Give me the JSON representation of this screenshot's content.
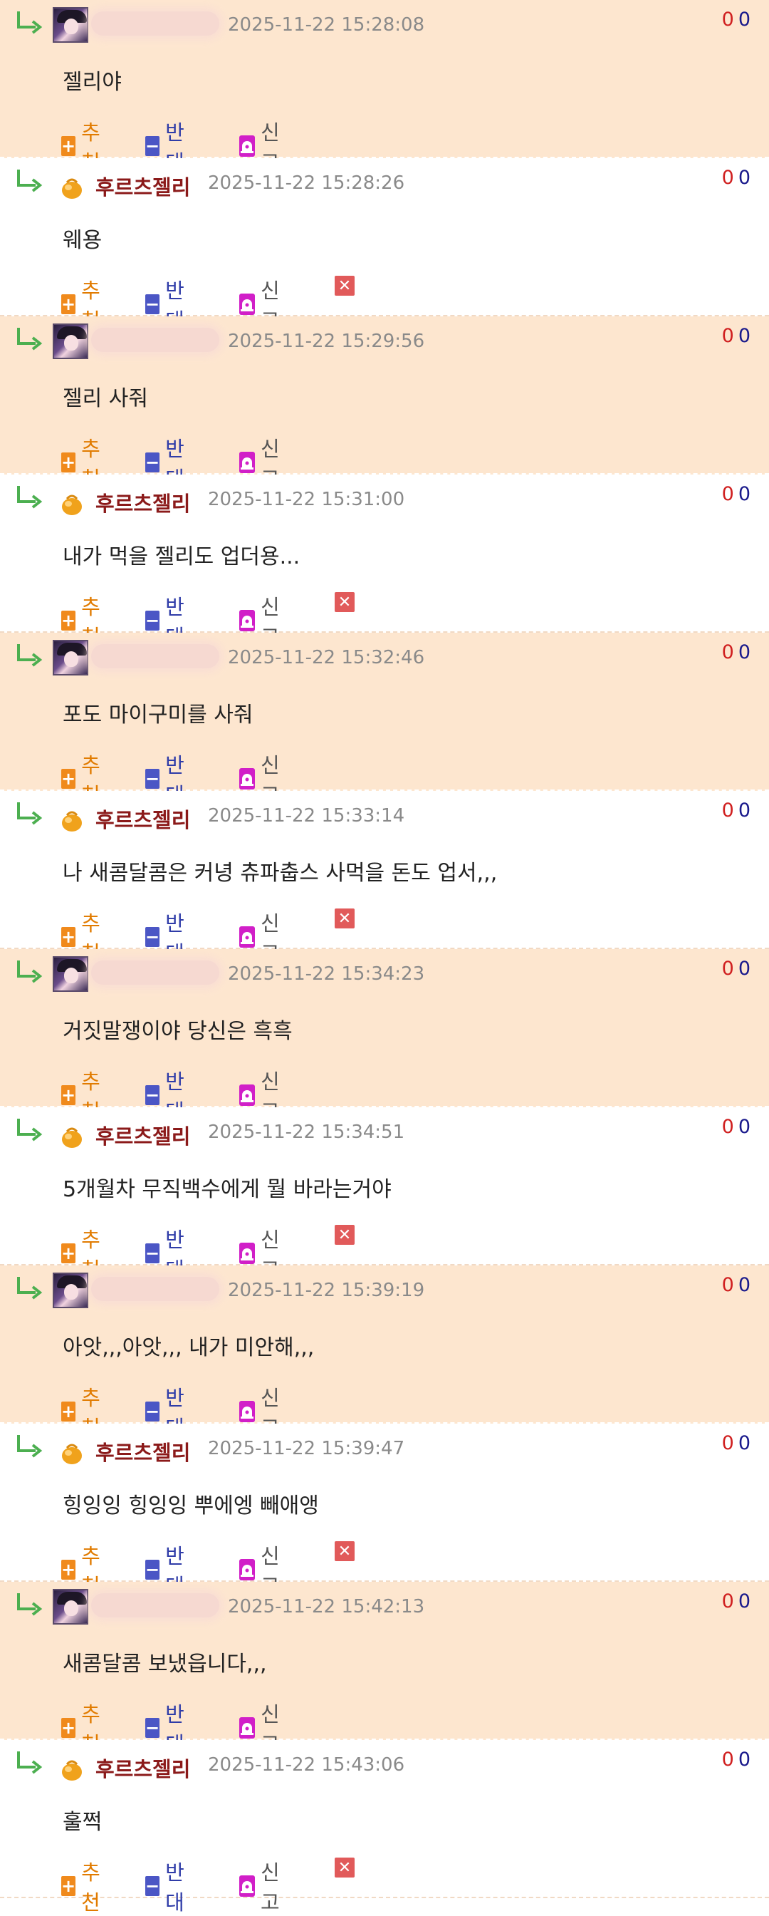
{
  "labels": {
    "recommend": "추천",
    "oppose": "반대",
    "report": "신고"
  },
  "comments": [
    {
      "kind": "other",
      "author": "",
      "timestamp": "2025-11-22 15:28:08",
      "text": "젤리야",
      "up": "0",
      "down": "0"
    },
    {
      "kind": "mine",
      "author": "후르츠젤리",
      "timestamp": "2025-11-22 15:28:26",
      "text": "웨용",
      "up": "0",
      "down": "0"
    },
    {
      "kind": "other",
      "author": "",
      "timestamp": "2025-11-22 15:29:56",
      "text": "젤리 사줘",
      "up": "0",
      "down": "0"
    },
    {
      "kind": "mine",
      "author": "후르츠젤리",
      "timestamp": "2025-11-22 15:31:00",
      "text": "내가 먹을 젤리도 업더용...",
      "up": "0",
      "down": "0"
    },
    {
      "kind": "other",
      "author": "",
      "timestamp": "2025-11-22 15:32:46",
      "text": "포도 마이구미를 사줘",
      "up": "0",
      "down": "0"
    },
    {
      "kind": "mine",
      "author": "후르츠젤리",
      "timestamp": "2025-11-22 15:33:14",
      "text": "나 새콤달콤은 커녕 츄파춥스 사먹을 돈도 업서,,,",
      "up": "0",
      "down": "0"
    },
    {
      "kind": "other",
      "author": "",
      "timestamp": "2025-11-22 15:34:23",
      "text": "거짓말쟁이야 당신은 흑흑",
      "up": "0",
      "down": "0"
    },
    {
      "kind": "mine",
      "author": "후르츠젤리",
      "timestamp": "2025-11-22 15:34:51",
      "text": "5개월차 무직백수에게 뭘 바라는거야",
      "up": "0",
      "down": "0"
    },
    {
      "kind": "other",
      "author": "",
      "timestamp": "2025-11-22 15:39:19",
      "text": "아앗,,,아앗,,, 내가 미안해,,,",
      "up": "0",
      "down": "0"
    },
    {
      "kind": "mine",
      "author": "후르츠젤리",
      "timestamp": "2025-11-22 15:39:47",
      "text": "힝잉잉 힝잉잉 뿌에엥 빼애앵",
      "up": "0",
      "down": "0"
    },
    {
      "kind": "other",
      "author": "",
      "timestamp": "2025-11-22 15:42:13",
      "text": "새콤달콤 보냈읍니다,,,",
      "up": "0",
      "down": "0"
    },
    {
      "kind": "mine",
      "author": "후르츠젤리",
      "timestamp": "2025-11-22 15:43:06",
      "text": "훌쩍",
      "up": "0",
      "down": "0"
    }
  ]
}
